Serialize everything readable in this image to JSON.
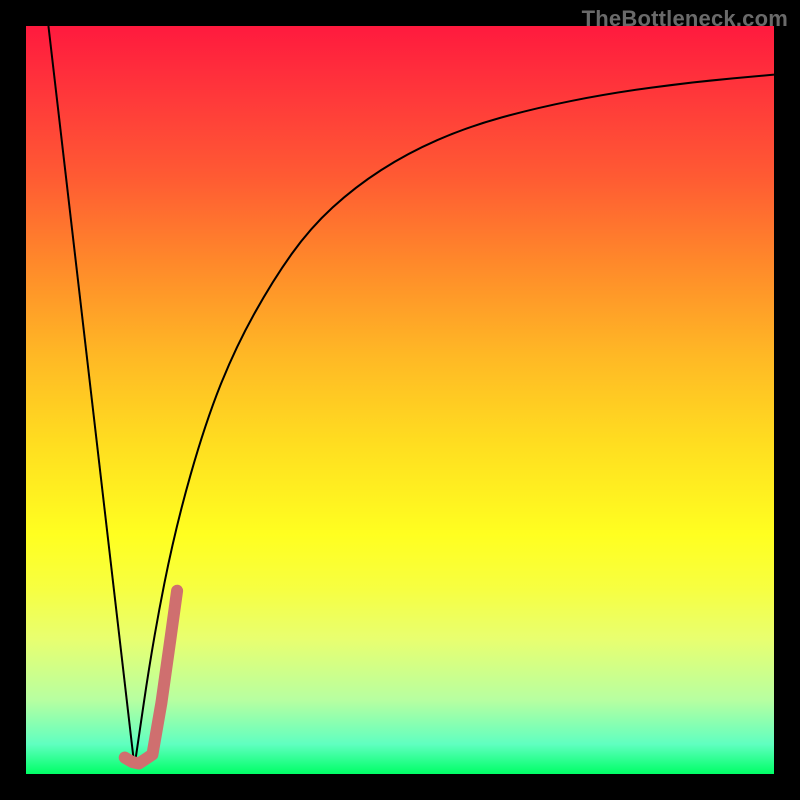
{
  "watermark": "TheBottleneck.com",
  "chart_data": {
    "type": "line",
    "title": "",
    "xlabel": "",
    "ylabel": "",
    "xlim": [
      0,
      100
    ],
    "ylim": [
      0,
      100
    ],
    "grid": false,
    "series": [
      {
        "name": "descending-line",
        "stroke": "#000000",
        "width": 2,
        "x": [
          3,
          14.5
        ],
        "values": [
          100,
          1
        ]
      },
      {
        "name": "saturating-curve",
        "stroke": "#000000",
        "width": 2,
        "x": [
          14.5,
          17,
          20,
          24,
          28,
          33,
          38,
          44,
          51,
          59,
          68,
          78,
          89,
          100
        ],
        "values": [
          1,
          18,
          33,
          47,
          57,
          66,
          73,
          78.5,
          83,
          86.5,
          89,
          91,
          92.5,
          93.5
        ]
      },
      {
        "name": "pink-j-segment",
        "stroke": "#cf6f6f",
        "width": 12,
        "linecap": "round",
        "x": [
          13.2,
          14.2,
          15.1,
          16.9,
          18.1,
          19.3,
          20.2
        ],
        "values": [
          2.2,
          1.6,
          1.4,
          2.6,
          9.5,
          18.0,
          24.5
        ]
      }
    ],
    "background_gradient": {
      "direction": "top-to-bottom",
      "stops": [
        {
          "pos": 0.0,
          "color": "#ff1a3e"
        },
        {
          "pos": 0.5,
          "color": "#ffd820"
        },
        {
          "pos": 0.8,
          "color": "#ffff40"
        },
        {
          "pos": 1.0,
          "color": "#00ff66"
        }
      ]
    }
  }
}
